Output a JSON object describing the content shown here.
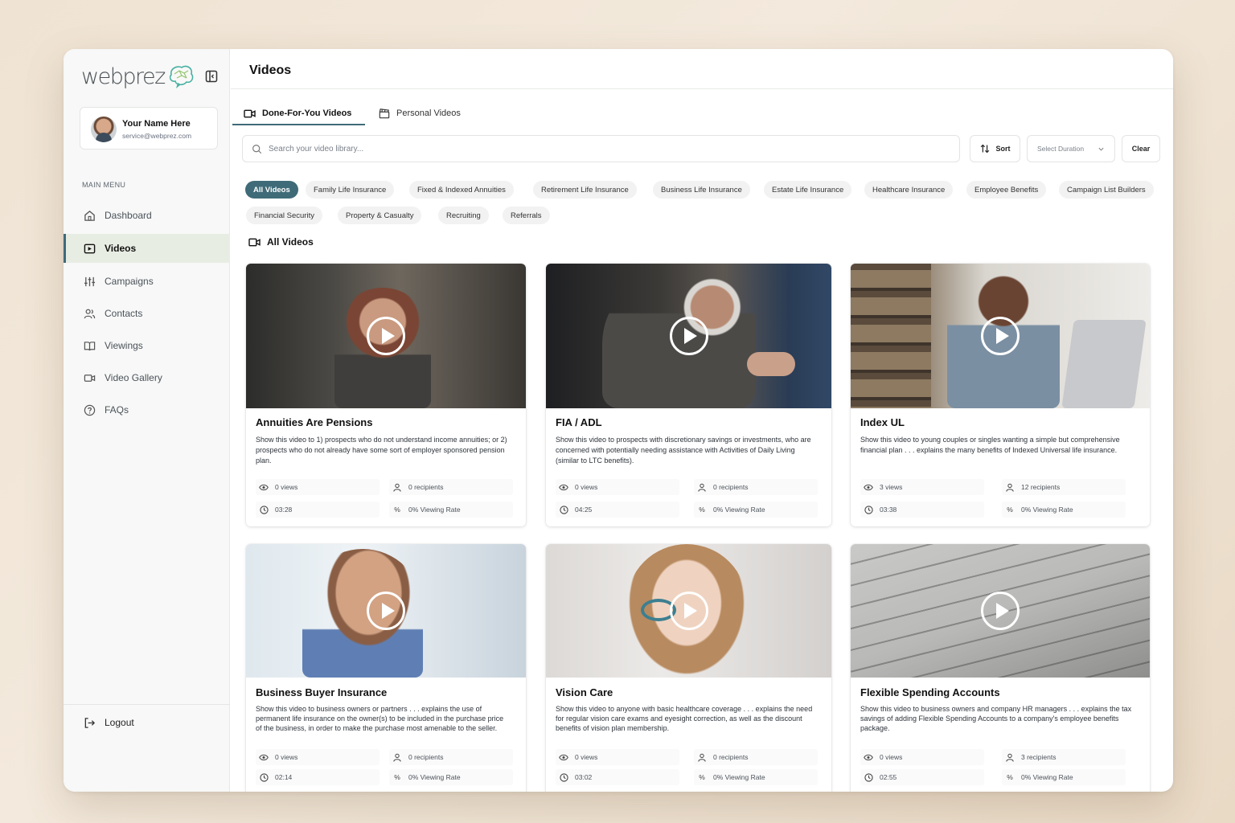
{
  "brand": {
    "logo_text": "webprez",
    "accent": "#3f6b78",
    "active_bg": "#e8ede4"
  },
  "user": {
    "name": "Your Name Here",
    "email": "service@webprez.com"
  },
  "sidebar": {
    "menu_label": "MAIN MENU",
    "items": [
      {
        "label": "Dashboard",
        "icon": "home-icon"
      },
      {
        "label": "Videos",
        "icon": "video-icon",
        "active": true
      },
      {
        "label": "Campaigns",
        "icon": "sliders-icon"
      },
      {
        "label": "Contacts",
        "icon": "users-icon"
      },
      {
        "label": "Viewings",
        "icon": "book-open-icon"
      },
      {
        "label": "Video Gallery",
        "icon": "video-camera-icon"
      },
      {
        "label": "FAQs",
        "icon": "help-circle-icon"
      }
    ],
    "logout_label": "Logout"
  },
  "header": {
    "title": "Videos"
  },
  "tabs": [
    {
      "label": "Done-For-You Videos",
      "active": true
    },
    {
      "label": "Personal Videos"
    }
  ],
  "search": {
    "placeholder": "Search your video library..."
  },
  "toolbar": {
    "sort_label": "Sort",
    "duration_label": "Select Duration",
    "clear_label": "Clear"
  },
  "categories": [
    "All Videos",
    "Family Life Insurance",
    "Fixed & Indexed Annuities",
    "Retirement Life Insurance",
    "Business Life Insurance",
    "Estate Life Insurance",
    "Healthcare Insurance",
    "Employee Benefits",
    "Campaign List Builders",
    "Financial Security",
    "Property & Casualty",
    "Recruiting",
    "Referrals"
  ],
  "section_title": "All Videos",
  "videos": [
    {
      "title": "Annuities Are Pensions",
      "description": "Show this video to 1) prospects who do not understand income annuities; or 2) prospects who do not already have some sort of employer sponsored pension plan.",
      "views": "0 views",
      "recipients": "0 recipients",
      "duration": "03:28",
      "viewing_rate": "0% Viewing Rate"
    },
    {
      "title": "FIA / ADL",
      "description": "Show this video to prospects with discretionary savings or investments, who are concerned with potentially needing assistance with Activities of Daily Living (similar to LTC benefits).",
      "views": "0 views",
      "recipients": "0 recipients",
      "duration": "04:25",
      "viewing_rate": "0% Viewing Rate"
    },
    {
      "title": "Index UL",
      "description": "Show this video to young couples or singles wanting a simple but comprehensive financial plan . . . explains the many benefits of Indexed Universal life insurance.",
      "views": "3 views",
      "recipients": "12 recipients",
      "duration": "03:38",
      "viewing_rate": "0% Viewing Rate"
    },
    {
      "title": "Business Buyer Insurance",
      "description": "Show this video to business owners or partners . . . explains the use of permanent life insurance on the owner(s) to be included in the purchase price of the business, in order to make the purchase most amenable to the seller.",
      "views": "0 views",
      "recipients": "0 recipients",
      "duration": "02:14",
      "viewing_rate": "0% Viewing Rate"
    },
    {
      "title": "Vision Care",
      "description": "Show this video to anyone with basic healthcare coverage . . . explains the need for regular vision care exams and eyesight correction, as well as the discount benefits of vision plan membership.",
      "views": "0 views",
      "recipients": "0 recipients",
      "duration": "03:02",
      "viewing_rate": "0% Viewing Rate"
    },
    {
      "title": "Flexible Spending Accounts",
      "description": "Show this video to business owners and company HR managers . . . explains the tax savings of adding Flexible Spending Accounts to a company's employee benefits package.",
      "views": "0 views",
      "recipients": "3 recipients",
      "duration": "02:55",
      "viewing_rate": "0% Viewing Rate"
    }
  ]
}
